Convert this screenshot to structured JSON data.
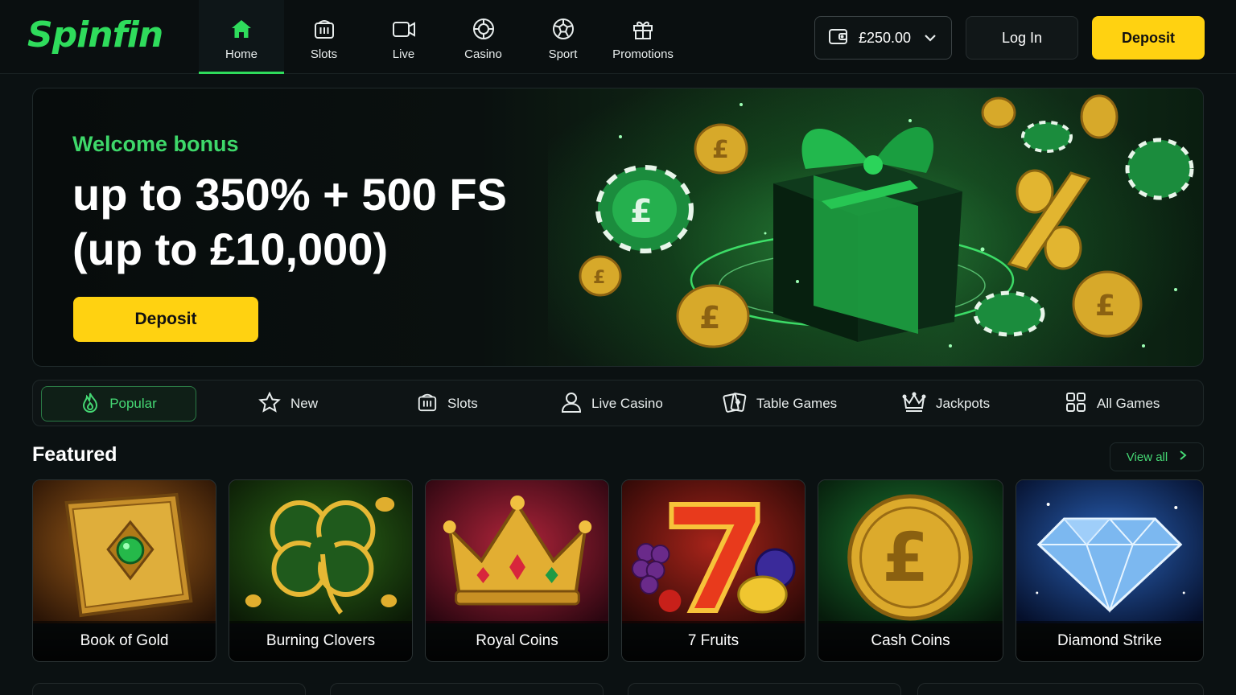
{
  "brand": {
    "name": "Spinfin",
    "accent": "#2fdc5c",
    "cta": "#ffd211"
  },
  "nav": [
    {
      "label": "Home",
      "icon": "home-icon",
      "active": true
    },
    {
      "label": "Slots",
      "icon": "slot-machine-icon"
    },
    {
      "label": "Live",
      "icon": "live-tv-icon"
    },
    {
      "label": "Casino",
      "icon": "casino-chip-icon"
    },
    {
      "label": "Sport",
      "icon": "soccer-ball-icon"
    },
    {
      "label": "Promotions",
      "icon": "gift-icon"
    }
  ],
  "header": {
    "balance": "£250.00",
    "login_label": "Log In",
    "deposit_label": "Deposit"
  },
  "hero": {
    "eyebrow": "Welcome bonus",
    "title_line1": "up to 350% + 500 FS",
    "title_line2": "(up to £10,000)",
    "cta_label": "Deposit"
  },
  "categories": [
    {
      "label": "Popular",
      "icon": "flame-icon",
      "active": true
    },
    {
      "label": "New",
      "icon": "star-icon"
    },
    {
      "label": "Slots",
      "icon": "slot-machine-icon"
    },
    {
      "label": "Live Casino",
      "icon": "dealer-icon"
    },
    {
      "label": "Table Games",
      "icon": "cards-icon"
    },
    {
      "label": "Jackpots",
      "icon": "crown-icon"
    },
    {
      "label": "All Games",
      "icon": "grid-icon"
    }
  ],
  "featured": {
    "title": "Featured",
    "view_all_label": "View all",
    "games": [
      {
        "name": "Book of Gold",
        "theme": "book"
      },
      {
        "name": "Burning Clovers",
        "theme": "clover"
      },
      {
        "name": "Royal Coins",
        "theme": "crown"
      },
      {
        "name": "7 Fruits",
        "theme": "seven"
      },
      {
        "name": "Cash Coins",
        "theme": "coin"
      },
      {
        "name": "Diamond Strike",
        "theme": "diamond"
      }
    ]
  }
}
